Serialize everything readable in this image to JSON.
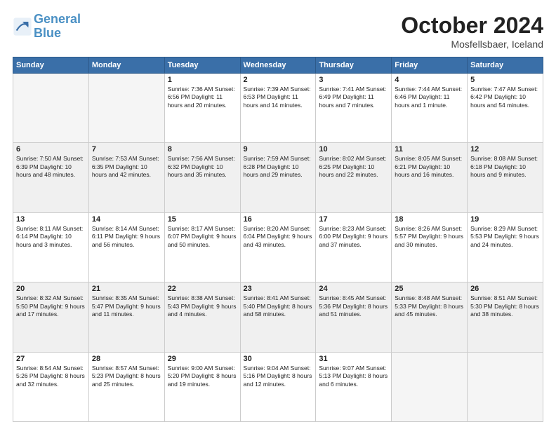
{
  "logo": {
    "line1": "General",
    "line2": "Blue"
  },
  "title": "October 2024",
  "location": "Mosfellsbaer, Iceland",
  "weekdays": [
    "Sunday",
    "Monday",
    "Tuesday",
    "Wednesday",
    "Thursday",
    "Friday",
    "Saturday"
  ],
  "weeks": [
    [
      {
        "day": "",
        "info": ""
      },
      {
        "day": "",
        "info": ""
      },
      {
        "day": "1",
        "info": "Sunrise: 7:36 AM\nSunset: 6:56 PM\nDaylight: 11 hours\nand 20 minutes."
      },
      {
        "day": "2",
        "info": "Sunrise: 7:39 AM\nSunset: 6:53 PM\nDaylight: 11 hours\nand 14 minutes."
      },
      {
        "day": "3",
        "info": "Sunrise: 7:41 AM\nSunset: 6:49 PM\nDaylight: 11 hours\nand 7 minutes."
      },
      {
        "day": "4",
        "info": "Sunrise: 7:44 AM\nSunset: 6:46 PM\nDaylight: 11 hours\nand 1 minute."
      },
      {
        "day": "5",
        "info": "Sunrise: 7:47 AM\nSunset: 6:42 PM\nDaylight: 10 hours\nand 54 minutes."
      }
    ],
    [
      {
        "day": "6",
        "info": "Sunrise: 7:50 AM\nSunset: 6:39 PM\nDaylight: 10 hours\nand 48 minutes."
      },
      {
        "day": "7",
        "info": "Sunrise: 7:53 AM\nSunset: 6:35 PM\nDaylight: 10 hours\nand 42 minutes."
      },
      {
        "day": "8",
        "info": "Sunrise: 7:56 AM\nSunset: 6:32 PM\nDaylight: 10 hours\nand 35 minutes."
      },
      {
        "day": "9",
        "info": "Sunrise: 7:59 AM\nSunset: 6:28 PM\nDaylight: 10 hours\nand 29 minutes."
      },
      {
        "day": "10",
        "info": "Sunrise: 8:02 AM\nSunset: 6:25 PM\nDaylight: 10 hours\nand 22 minutes."
      },
      {
        "day": "11",
        "info": "Sunrise: 8:05 AM\nSunset: 6:21 PM\nDaylight: 10 hours\nand 16 minutes."
      },
      {
        "day": "12",
        "info": "Sunrise: 8:08 AM\nSunset: 6:18 PM\nDaylight: 10 hours\nand 9 minutes."
      }
    ],
    [
      {
        "day": "13",
        "info": "Sunrise: 8:11 AM\nSunset: 6:14 PM\nDaylight: 10 hours\nand 3 minutes."
      },
      {
        "day": "14",
        "info": "Sunrise: 8:14 AM\nSunset: 6:11 PM\nDaylight: 9 hours\nand 56 minutes."
      },
      {
        "day": "15",
        "info": "Sunrise: 8:17 AM\nSunset: 6:07 PM\nDaylight: 9 hours\nand 50 minutes."
      },
      {
        "day": "16",
        "info": "Sunrise: 8:20 AM\nSunset: 6:04 PM\nDaylight: 9 hours\nand 43 minutes."
      },
      {
        "day": "17",
        "info": "Sunrise: 8:23 AM\nSunset: 6:00 PM\nDaylight: 9 hours\nand 37 minutes."
      },
      {
        "day": "18",
        "info": "Sunrise: 8:26 AM\nSunset: 5:57 PM\nDaylight: 9 hours\nand 30 minutes."
      },
      {
        "day": "19",
        "info": "Sunrise: 8:29 AM\nSunset: 5:53 PM\nDaylight: 9 hours\nand 24 minutes."
      }
    ],
    [
      {
        "day": "20",
        "info": "Sunrise: 8:32 AM\nSunset: 5:50 PM\nDaylight: 9 hours\nand 17 minutes."
      },
      {
        "day": "21",
        "info": "Sunrise: 8:35 AM\nSunset: 5:47 PM\nDaylight: 9 hours\nand 11 minutes."
      },
      {
        "day": "22",
        "info": "Sunrise: 8:38 AM\nSunset: 5:43 PM\nDaylight: 9 hours\nand 4 minutes."
      },
      {
        "day": "23",
        "info": "Sunrise: 8:41 AM\nSunset: 5:40 PM\nDaylight: 8 hours\nand 58 minutes."
      },
      {
        "day": "24",
        "info": "Sunrise: 8:45 AM\nSunset: 5:36 PM\nDaylight: 8 hours\nand 51 minutes."
      },
      {
        "day": "25",
        "info": "Sunrise: 8:48 AM\nSunset: 5:33 PM\nDaylight: 8 hours\nand 45 minutes."
      },
      {
        "day": "26",
        "info": "Sunrise: 8:51 AM\nSunset: 5:30 PM\nDaylight: 8 hours\nand 38 minutes."
      }
    ],
    [
      {
        "day": "27",
        "info": "Sunrise: 8:54 AM\nSunset: 5:26 PM\nDaylight: 8 hours\nand 32 minutes."
      },
      {
        "day": "28",
        "info": "Sunrise: 8:57 AM\nSunset: 5:23 PM\nDaylight: 8 hours\nand 25 minutes."
      },
      {
        "day": "29",
        "info": "Sunrise: 9:00 AM\nSunset: 5:20 PM\nDaylight: 8 hours\nand 19 minutes."
      },
      {
        "day": "30",
        "info": "Sunrise: 9:04 AM\nSunset: 5:16 PM\nDaylight: 8 hours\nand 12 minutes."
      },
      {
        "day": "31",
        "info": "Sunrise: 9:07 AM\nSunset: 5:13 PM\nDaylight: 8 hours\nand 6 minutes."
      },
      {
        "day": "",
        "info": ""
      },
      {
        "day": "",
        "info": ""
      }
    ]
  ]
}
